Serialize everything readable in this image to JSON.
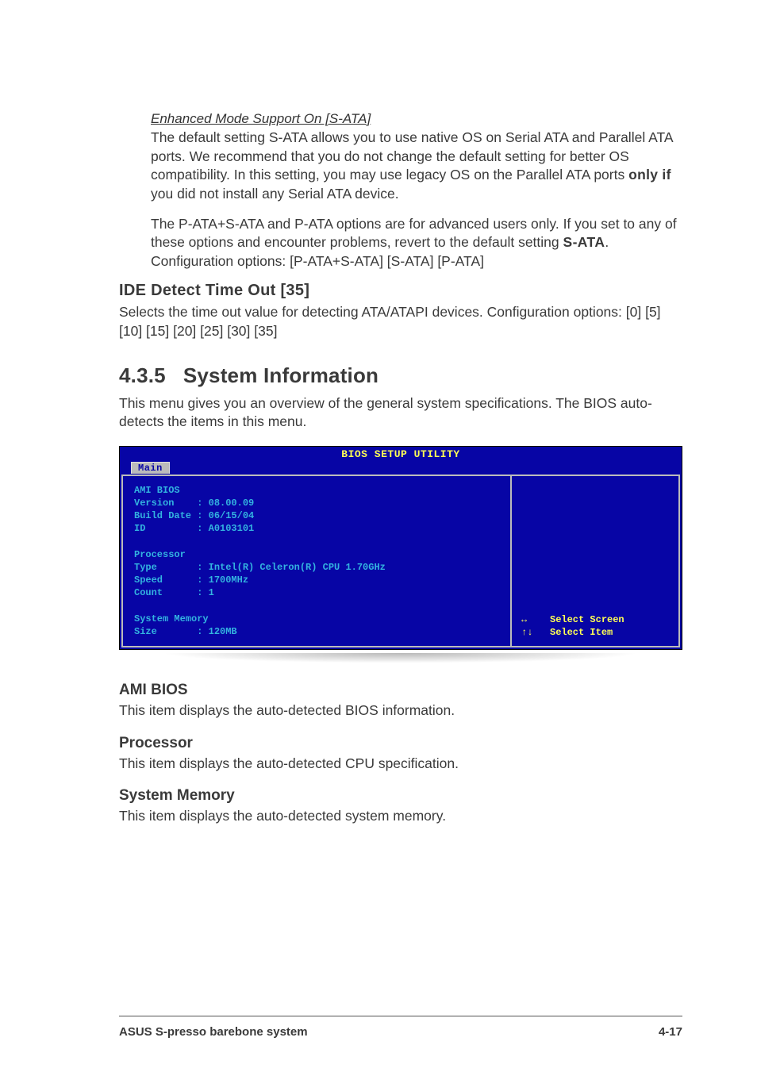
{
  "enhanced": {
    "title": "Enhanced Mode Support On [S-ATA]",
    "p1_a": "The default setting S-ATA allows you to use native OS on Serial ATA and Parallel ATA ports. We recommend that you do not change the default setting for better OS compatibility. In this setting, you may use legacy OS on the Parallel ATA ports ",
    "p1_bold": "only if",
    "p1_b": " you did not install any Serial ATA device.",
    "p2_a": "The P-ATA+S-ATA and P-ATA options are for advanced users only. If you set to any of these options and encounter problems, revert to the default setting ",
    "p2_bold": "S-ATA",
    "p2_b": ". Configuration options: [P-ATA+S-ATA] [S-ATA] [P-ATA]"
  },
  "ide": {
    "heading": "IDE Detect Time Out [35]",
    "body": "Selects the time out value for detecting ATA/ATAPI devices. Configuration options: [0] [5] [10] [15] [20] [25] [30] [35]"
  },
  "sysinfo": {
    "num": "4.3.5",
    "title": "System Information",
    "intro": "This menu gives you an overview of the general system specifications. The BIOS auto-detects the items in this menu."
  },
  "bios": {
    "header": "BIOS SETUP UTILITY",
    "tab": "Main",
    "left": "AMI BIOS\nVersion    : 08.00.09\nBuild Date : 06/15/04\nID         : A0103101\n\nProcessor\nType       : Intel(R) Celeron(R) CPU 1.70GHz\nSpeed      : 1700MHz\nCount      : 1\n\nSystem Memory\nSize       : 120MB",
    "hints": "↔    Select Screen\n↑↓   Select Item"
  },
  "items": {
    "ami": {
      "h": "AMI BIOS",
      "p": "This item displays the auto-detected BIOS information."
    },
    "proc": {
      "h": "Processor",
      "p": "This item displays the auto-detected CPU specification."
    },
    "mem": {
      "h": "System Memory",
      "p": "This item displays the auto-detected system memory."
    }
  },
  "footer": {
    "left": "ASUS S-presso barebone system",
    "right": "4-17"
  }
}
